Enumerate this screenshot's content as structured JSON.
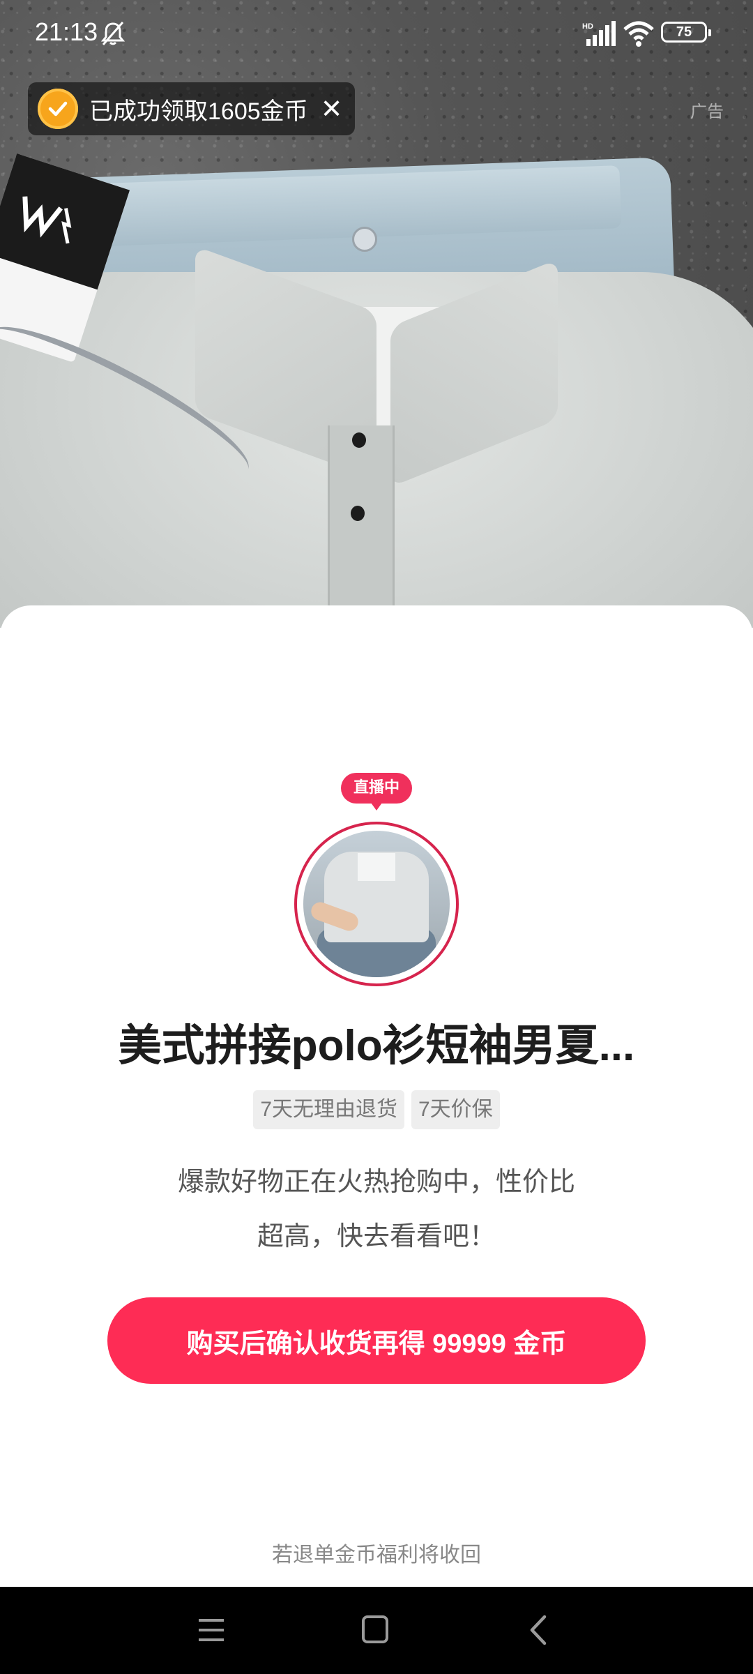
{
  "status_bar": {
    "time": "21:13",
    "battery_level": "75",
    "icons": [
      "mute-icon",
      "hd-signal-icon",
      "wifi-icon",
      "battery-icon"
    ]
  },
  "toast": {
    "message": "已成功领取1605金币",
    "icon": "check-circle-icon",
    "close_icon": "close-icon",
    "close_glyph": "✕"
  },
  "ad_label": "广告",
  "live": {
    "badge": "直播中"
  },
  "product": {
    "title": "美式拼接polo衫短袖男夏...",
    "tags": [
      "7天无理由退货",
      "7天价保"
    ],
    "description_line1": "爆款好物正在火热抢购中，性价比",
    "description_line2": "超高，快去看看吧！"
  },
  "cta": {
    "label": "购买后确认收货再得 99999 金币"
  },
  "footnote": "若退单金币福利将收回",
  "nav_bar": {
    "icons": [
      "menu-icon",
      "home-icon",
      "back-icon"
    ]
  },
  "colors": {
    "accent": "#fe2c55",
    "live_badge": "#f0305c",
    "coin": "#f7a51c",
    "nav_bg": "#000000"
  }
}
